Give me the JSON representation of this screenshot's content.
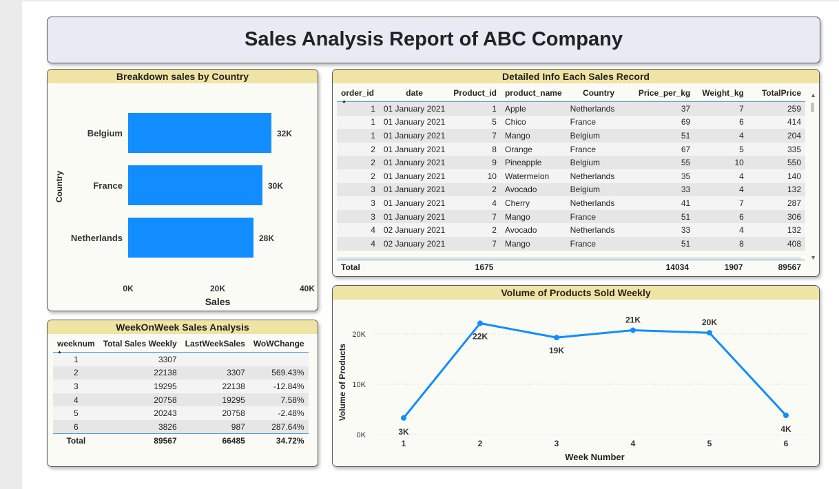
{
  "report_title": "Sales Analysis Report of ABC Company",
  "bar_panel": {
    "title": "Breakdown sales by Country"
  },
  "detail_panel": {
    "title": "Detailed Info Each Sales Record",
    "columns": [
      "order_id",
      "date",
      "Product_id",
      "product_name",
      "Country",
      "Price_per_kg",
      "Weight_kg",
      "TotalPrice"
    ],
    "rows": [
      [
        "1",
        "01 January 2021",
        "1",
        "Apple",
        "Netherlands",
        "37",
        "7",
        "259"
      ],
      [
        "1",
        "01 January 2021",
        "5",
        "Chico",
        "France",
        "69",
        "6",
        "414"
      ],
      [
        "1",
        "01 January 2021",
        "7",
        "Mango",
        "Belgium",
        "51",
        "4",
        "204"
      ],
      [
        "2",
        "01 January 2021",
        "8",
        "Orange",
        "France",
        "67",
        "5",
        "335"
      ],
      [
        "2",
        "01 January 2021",
        "9",
        "Pineapple",
        "Belgium",
        "55",
        "10",
        "550"
      ],
      [
        "2",
        "01 January 2021",
        "10",
        "Watermelon",
        "Netherlands",
        "35",
        "4",
        "140"
      ],
      [
        "3",
        "01 January 2021",
        "2",
        "Avocado",
        "Belgium",
        "33",
        "4",
        "132"
      ],
      [
        "3",
        "01 January 2021",
        "4",
        "Cherry",
        "Netherlands",
        "41",
        "7",
        "287"
      ],
      [
        "3",
        "01 January 2021",
        "7",
        "Mango",
        "France",
        "51",
        "6",
        "306"
      ],
      [
        "4",
        "02 January 2021",
        "2",
        "Avocado",
        "Netherlands",
        "33",
        "4",
        "132"
      ],
      [
        "4",
        "02 January 2021",
        "7",
        "Mango",
        "France",
        "51",
        "8",
        "408"
      ]
    ],
    "total": {
      "label": "Total",
      "product_id": "1675",
      "price_per_kg": "14034",
      "weight_kg": "1907",
      "total_price": "89567"
    }
  },
  "wow_panel": {
    "title": "WeekOnWeek Sales Analysis",
    "columns": [
      "weeknum",
      "Total Sales Weekly",
      "LastWeekSales",
      "WoWChange"
    ],
    "rows": [
      [
        "1",
        "3307",
        "",
        ""
      ],
      [
        "2",
        "22138",
        "3307",
        "569.43%"
      ],
      [
        "3",
        "19295",
        "22138",
        "-12.84%"
      ],
      [
        "4",
        "20758",
        "19295",
        "7.58%"
      ],
      [
        "5",
        "20243",
        "20758",
        "-2.48%"
      ],
      [
        "6",
        "3826",
        "987",
        "287.64%"
      ]
    ],
    "total": [
      "Total",
      "89567",
      "66485",
      "34.72%"
    ]
  },
  "line_panel": {
    "title": "Volume of Products Sold Weekly"
  },
  "colors": {
    "accent": "#118dff",
    "title_bar": "#f0e4a4",
    "header_bg": "#e8eaf4"
  },
  "chart_data": [
    {
      "type": "bar",
      "orientation": "horizontal",
      "title": "Breakdown sales by Country",
      "categories": [
        "Belgium",
        "France",
        "Netherlands"
      ],
      "values": [
        32000,
        30000,
        28000
      ],
      "data_labels": [
        "32K",
        "30K",
        "28K"
      ],
      "xlabel": "Sales",
      "ylabel": "Country",
      "xlim": [
        0,
        40000
      ],
      "x_ticks": [
        "0K",
        "20K",
        "40K"
      ],
      "grid": false
    },
    {
      "type": "line",
      "title": "Volume of Products Sold Weekly",
      "x": [
        "1",
        "2",
        "3",
        "4",
        "5",
        "6"
      ],
      "values": [
        3307,
        22138,
        19295,
        20758,
        20243,
        3826
      ],
      "data_labels": [
        "3K",
        "22K",
        "19K",
        "21K",
        "20K",
        "4K"
      ],
      "xlabel": "Week Number",
      "ylabel": "Volume of Products",
      "ylim": [
        0,
        24000
      ],
      "y_ticks": [
        "0K",
        "10K",
        "20K"
      ],
      "grid": true
    }
  ]
}
